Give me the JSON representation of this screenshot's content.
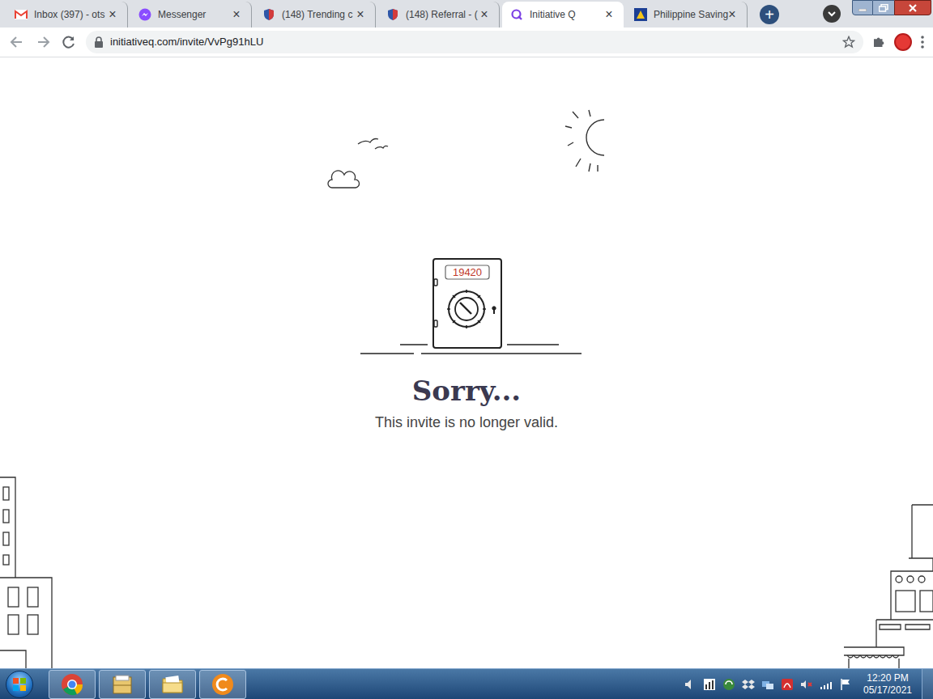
{
  "browser": {
    "tabs": [
      {
        "label": "Inbox (397) - ots",
        "selected": false
      },
      {
        "label": "Messenger",
        "selected": false
      },
      {
        "label": "(148) Trending c",
        "selected": false
      },
      {
        "label": "(148) Referral - (",
        "selected": false
      },
      {
        "label": "Initiative Q",
        "selected": true
      },
      {
        "label": "Philippine Saving",
        "selected": false
      }
    ],
    "close_glyph": "×",
    "new_tab": "+",
    "address": "initiativeq.com/invite/VvPg91hLU"
  },
  "page": {
    "counter": "19420",
    "heading": "Sorry...",
    "message": "This invite is no longer valid."
  },
  "taskbar": {
    "time": "12:20 PM",
    "date": "05/17/2021"
  }
}
